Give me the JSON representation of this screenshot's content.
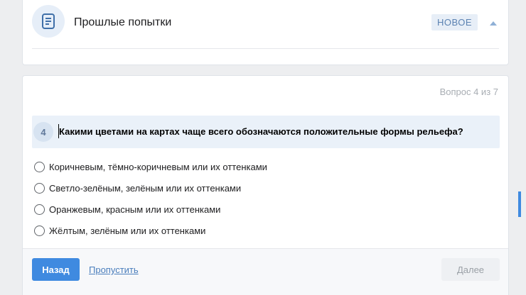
{
  "attempts": {
    "title": "Прошлые попытки",
    "badge": "НОВОЕ",
    "icon": "document-list-icon",
    "collapse_icon": "chevron-up-icon"
  },
  "question": {
    "progress": "Вопрос 4 из 7",
    "number": "4",
    "text": "Какими цветами на картах чаще всего обозначаются положительные формы рельефа?",
    "options": [
      {
        "label": "Коричневым, тёмно-коричневым или их оттенками",
        "selected": false
      },
      {
        "label": "Светло-зелёным, зелёным или их оттенками",
        "selected": false
      },
      {
        "label": "Оранжевым, красным или их оттенками",
        "selected": false
      },
      {
        "label": "Жёлтым, зелёным или их оттенками",
        "selected": false
      }
    ]
  },
  "footer": {
    "back_label": "Назад",
    "skip_label": "Пропустить",
    "next_label": "Далее"
  },
  "colors": {
    "accent": "#3f8ae0",
    "background": "#edeef0",
    "question_header_bg": "#eaf1f9"
  }
}
